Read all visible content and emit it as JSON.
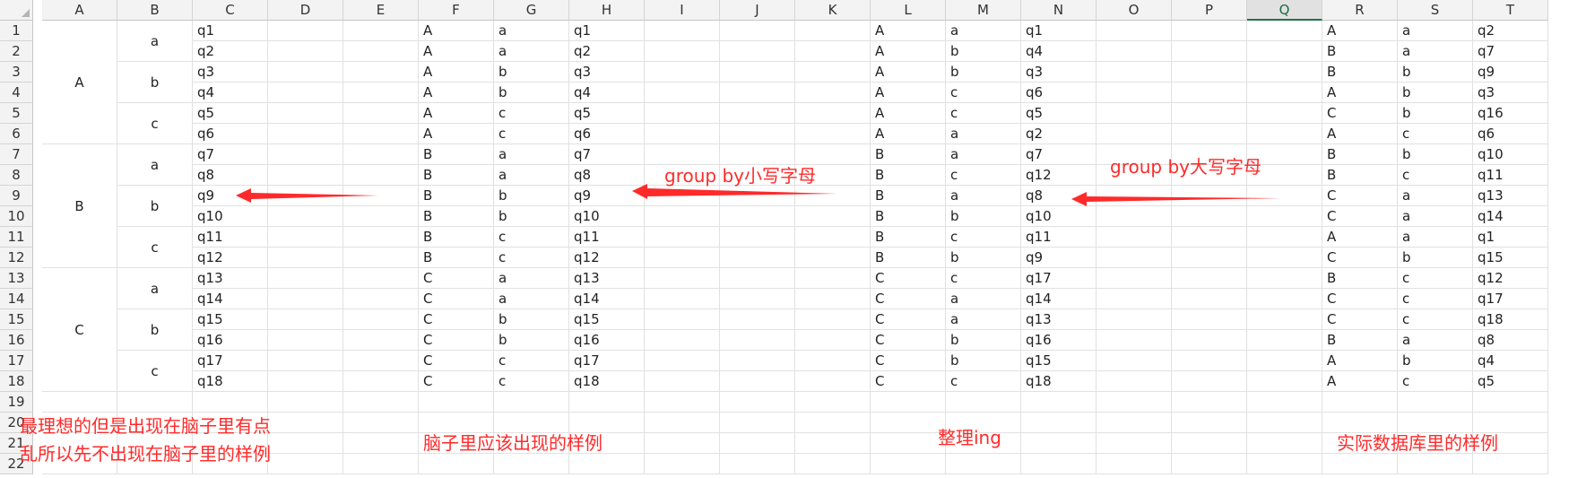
{
  "columns": [
    "A",
    "B",
    "C",
    "D",
    "E",
    "F",
    "G",
    "H",
    "I",
    "J",
    "K",
    "L",
    "M",
    "N",
    "O",
    "P",
    "Q",
    "R",
    "S",
    "T"
  ],
  "selected_column": "Q",
  "rows": [
    "1",
    "2",
    "3",
    "4",
    "5",
    "6",
    "7",
    "8",
    "9",
    "10",
    "11",
    "12",
    "13",
    "14",
    "15",
    "16",
    "17",
    "18",
    "19",
    "20",
    "21",
    "22"
  ],
  "merged": {
    "A": [
      "A",
      "B",
      "C"
    ],
    "B": [
      "a",
      "b",
      "c",
      "a",
      "b",
      "c",
      "a",
      "b",
      "c"
    ]
  },
  "colC": [
    "q1",
    "q2",
    "q3",
    "q4",
    "q5",
    "q6",
    "q7",
    "q8",
    "q9",
    "q10",
    "q11",
    "q12",
    "q13",
    "q14",
    "q15",
    "q16",
    "q17",
    "q18"
  ],
  "blockFGH": [
    [
      "A",
      "a",
      "q1"
    ],
    [
      "A",
      "a",
      "q2"
    ],
    [
      "A",
      "b",
      "q3"
    ],
    [
      "A",
      "b",
      "q4"
    ],
    [
      "A",
      "c",
      "q5"
    ],
    [
      "A",
      "c",
      "q6"
    ],
    [
      "B",
      "a",
      "q7"
    ],
    [
      "B",
      "a",
      "q8"
    ],
    [
      "B",
      "b",
      "q9"
    ],
    [
      "B",
      "b",
      "q10"
    ],
    [
      "B",
      "c",
      "q11"
    ],
    [
      "B",
      "c",
      "q12"
    ],
    [
      "C",
      "a",
      "q13"
    ],
    [
      "C",
      "a",
      "q14"
    ],
    [
      "C",
      "b",
      "q15"
    ],
    [
      "C",
      "b",
      "q16"
    ],
    [
      "C",
      "c",
      "q17"
    ],
    [
      "C",
      "c",
      "q18"
    ]
  ],
  "blockLMN": [
    [
      "A",
      "a",
      "q1"
    ],
    [
      "A",
      "b",
      "q4"
    ],
    [
      "A",
      "b",
      "q3"
    ],
    [
      "A",
      "c",
      "q6"
    ],
    [
      "A",
      "c",
      "q5"
    ],
    [
      "A",
      "a",
      "q2"
    ],
    [
      "B",
      "a",
      "q7"
    ],
    [
      "B",
      "c",
      "q12"
    ],
    [
      "B",
      "a",
      "q8"
    ],
    [
      "B",
      "b",
      "q10"
    ],
    [
      "B",
      "c",
      "q11"
    ],
    [
      "B",
      "b",
      "q9"
    ],
    [
      "C",
      "c",
      "q17"
    ],
    [
      "C",
      "a",
      "q14"
    ],
    [
      "C",
      "a",
      "q13"
    ],
    [
      "C",
      "b",
      "q16"
    ],
    [
      "C",
      "b",
      "q15"
    ],
    [
      "C",
      "c",
      "q18"
    ]
  ],
  "blockRST": [
    [
      "A",
      "a",
      "q2"
    ],
    [
      "B",
      "a",
      "q7"
    ],
    [
      "B",
      "b",
      "q9"
    ],
    [
      "A",
      "b",
      "q3"
    ],
    [
      "C",
      "b",
      "q16"
    ],
    [
      "A",
      "c",
      "q6"
    ],
    [
      "B",
      "b",
      "q10"
    ],
    [
      "B",
      "c",
      "q11"
    ],
    [
      "C",
      "a",
      "q13"
    ],
    [
      "C",
      "a",
      "q14"
    ],
    [
      "A",
      "a",
      "q1"
    ],
    [
      "C",
      "b",
      "q15"
    ],
    [
      "B",
      "c",
      "q12"
    ],
    [
      "C",
      "c",
      "q17"
    ],
    [
      "C",
      "c",
      "q18"
    ],
    [
      "B",
      "a",
      "q8"
    ],
    [
      "A",
      "b",
      "q4"
    ],
    [
      "A",
      "c",
      "q5"
    ]
  ],
  "annotations": {
    "group_lower": "group by小写字母",
    "group_upper": "group by大写字母",
    "ideal_line1": "最理想的但是出现在脑子里有点",
    "ideal_line2": "乱所以先不出现在脑子里的样例",
    "should_appear": "脑子里应该出现的样例",
    "organizing": "整理ing",
    "actual_db": "实际数据库里的样例"
  },
  "colors": {
    "annotation": "#ff2a2a",
    "selected_header": "#217346"
  }
}
